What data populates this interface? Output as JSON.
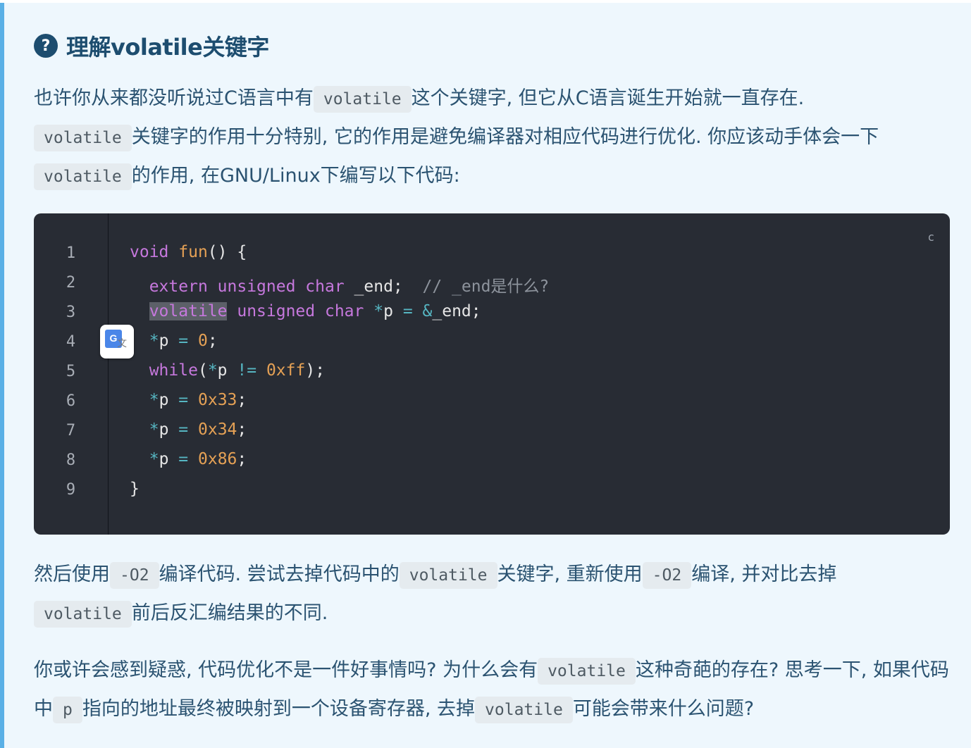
{
  "heading": {
    "icon": "question-circle-icon",
    "title": "理解volatile关键字"
  },
  "intro": {
    "p1_a": "也许你从来都没听说过C语言中有",
    "p1_code": "volatile",
    "p1_b": "这个关键字, 但它从C语言诞生开始就一直存在.",
    "p2_code": "volatile",
    "p2_a": "关键字的作用十分特别, 它的作用是避免编译器对相应代码进行优化. 你应该动手体会一下",
    "p2_code2": "volatile",
    "p2_b": "的作用, 在GNU/Linux下编写以下代码:"
  },
  "code": {
    "language": "c",
    "line_numbers": [
      "1",
      "2",
      "3",
      "4",
      "5",
      "6",
      "7",
      "8",
      "9"
    ],
    "lines": [
      "void fun() {",
      "  extern unsigned char _end;  // _end是什么?",
      "  volatile unsigned char *p = &_end;",
      "  *p = 0;",
      "  while(*p != 0xff);",
      "  *p = 0x33;",
      "  *p = 0x34;",
      "  *p = 0x86;",
      "}"
    ],
    "tokens": {
      "void": "void",
      "fun": "fun",
      "open": "() {",
      "extern": "extern",
      "unsigned": "unsigned",
      "char": "char",
      "end_decl": "_end;",
      "comment": "// _end是什么?",
      "volatile": "volatile",
      "star": "*",
      "p": "p",
      "eq": "=",
      "amp": "&",
      "end_ref": "_end;",
      "zero": "0",
      "semi": ";",
      "while": "while",
      "paren_open": "(",
      "neq": "!=",
      "hexff": "0xff",
      "paren_close": ");",
      "h33": "0x33",
      "h34": "0x34",
      "h86": "0x86",
      "close": "}"
    }
  },
  "after": {
    "p1_a": "然后使用",
    "p1_code": "-O2",
    "p1_b": "编译代码. 尝试去掉代码中的",
    "p1_code2": "volatile",
    "p1_c": "关键字, 重新使用",
    "p1_code3": "-O2",
    "p1_d": "编译, 并对比去掉",
    "p1_code4": "volatile",
    "p1_e": "前后反汇编结果的不同."
  },
  "question": {
    "a": "你或许会感到疑惑, 代码优化不是一件好事情吗? 为什么会有",
    "code1": "volatile",
    "b": "这种奇葩的存在? 思考一下, 如果代码中",
    "code2": "p",
    "c": "指向的地址最终被映射到一个设备寄存器, 去掉",
    "code3": "volatile",
    "d": "可能会带来什么问题?"
  },
  "translate_widget": {
    "icon": "google-translate-icon",
    "g": "G",
    "z": "文"
  },
  "colors": {
    "panel_bg": "#eef7fd",
    "panel_border": "#5ab0e6",
    "heading": "#1d4d6f",
    "text": "#2b5371",
    "code_bg": "#282c34"
  }
}
